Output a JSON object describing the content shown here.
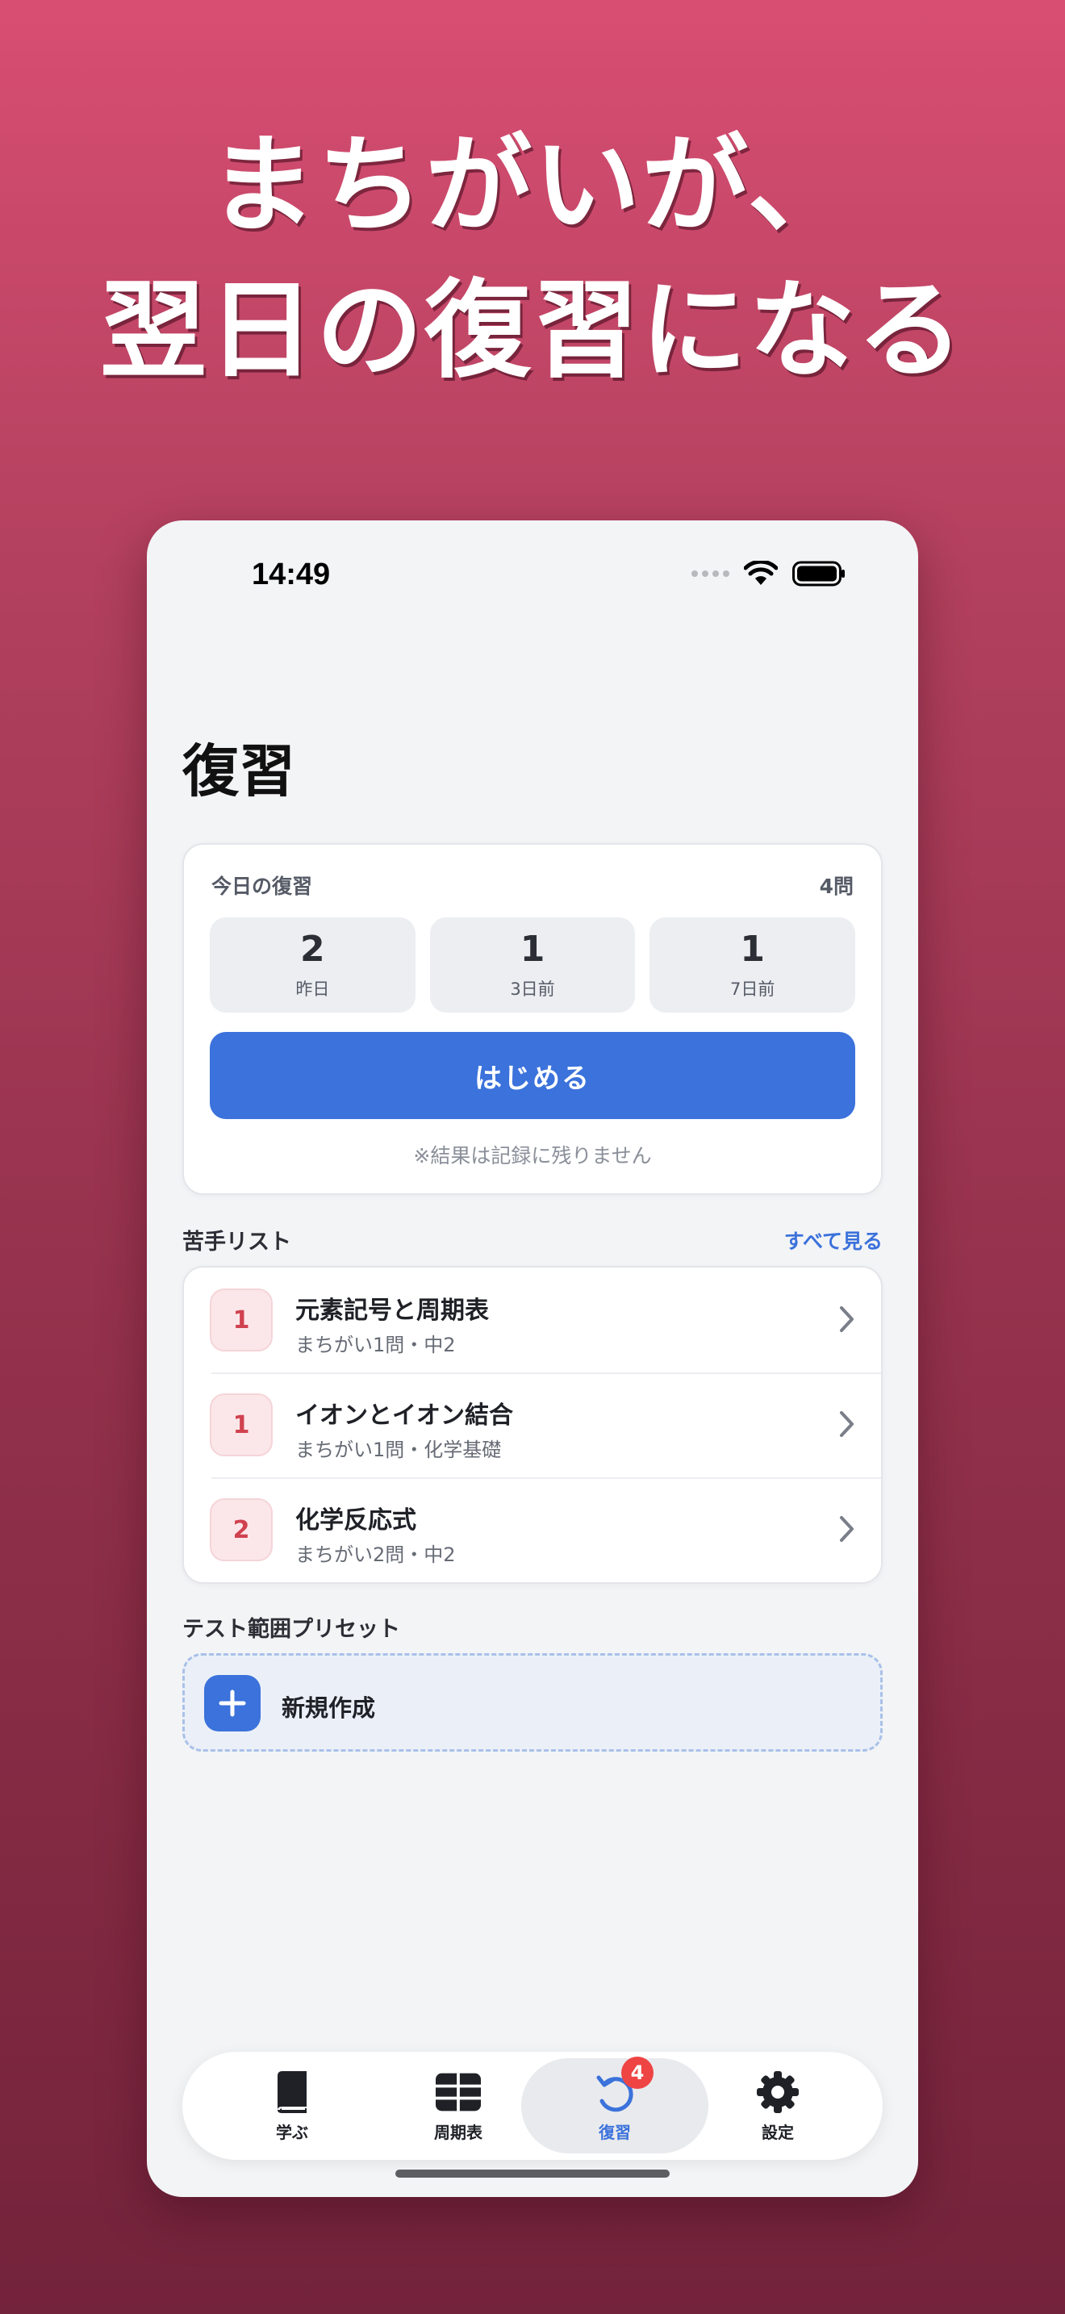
{
  "headline": {
    "line1": "まちがいが、",
    "line2": "翌日の復習になる"
  },
  "status_bar": {
    "time": "14:49"
  },
  "page": {
    "title": "復習"
  },
  "review": {
    "heading": "今日の復習",
    "total": "4問",
    "stats": [
      {
        "value": "2",
        "label": "昨日"
      },
      {
        "value": "1",
        "label": "3日前"
      },
      {
        "value": "1",
        "label": "7日前"
      }
    ],
    "start_label": "はじめる",
    "note": "※結果は記録に残りません"
  },
  "weak_list": {
    "heading": "苦手リスト",
    "see_all": "すべて見る",
    "items": [
      {
        "count": "1",
        "title": "元素記号と周期表",
        "subtitle": "まちがい1問・中2"
      },
      {
        "count": "1",
        "title": "イオンとイオン結合",
        "subtitle": "まちがい1問・化学基礎"
      },
      {
        "count": "2",
        "title": "化学反応式",
        "subtitle": "まちがい2問・中2"
      }
    ]
  },
  "presets": {
    "heading": "テスト範囲プリセット",
    "new_label": "新規作成"
  },
  "tabbar": {
    "tabs": [
      {
        "label": "学ぶ",
        "icon": "book-icon"
      },
      {
        "label": "周期表",
        "icon": "table-icon"
      },
      {
        "label": "復習",
        "icon": "review-icon",
        "badge": "4",
        "active": true
      },
      {
        "label": "設定",
        "icon": "gear-icon"
      }
    ]
  },
  "colors": {
    "accent": "#3b72db",
    "badge_red": "#ef4444",
    "weak_red": "#d0424f"
  }
}
